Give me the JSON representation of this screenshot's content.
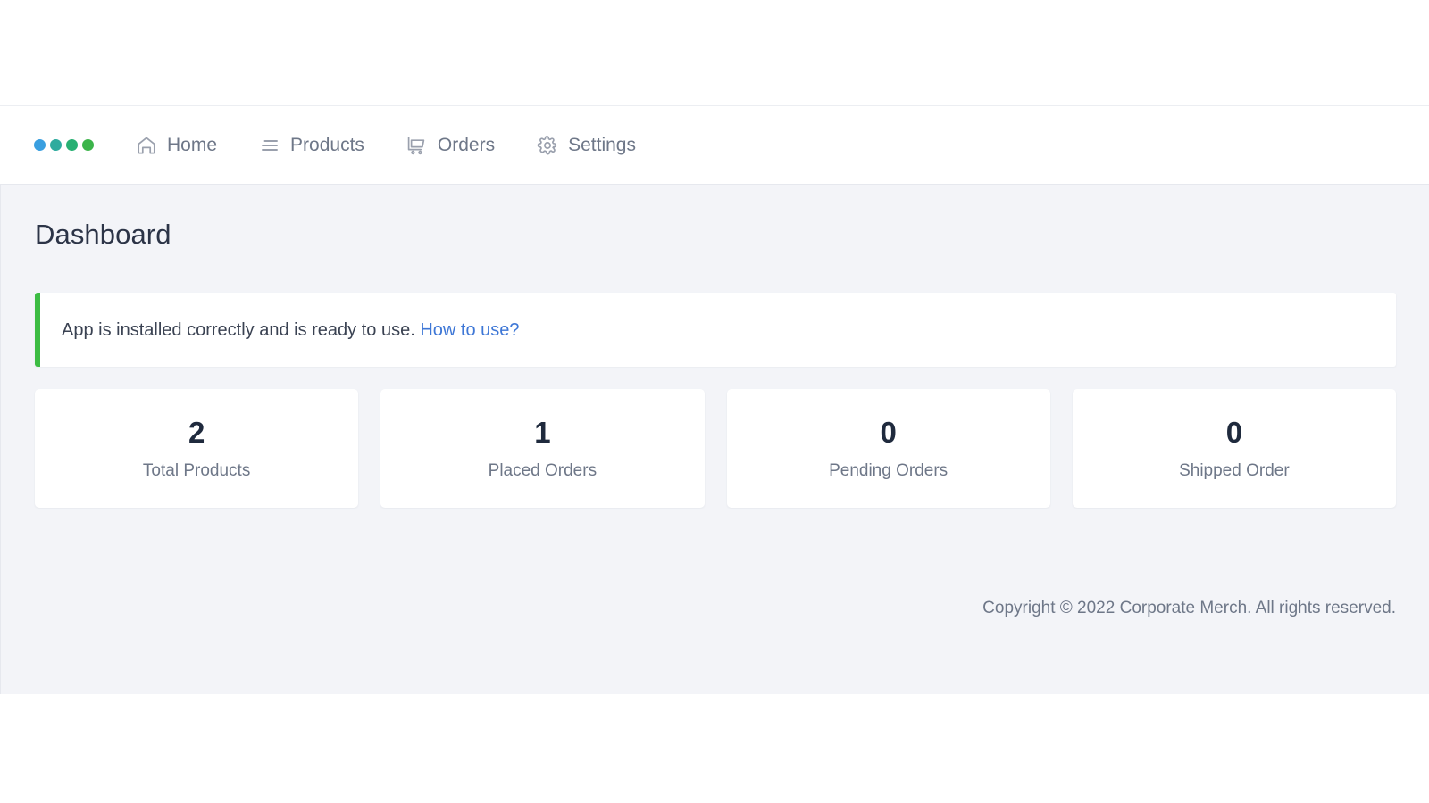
{
  "brand": {
    "name": "corporate-merch-logo",
    "dots": [
      {
        "color": "#3a9fe0"
      },
      {
        "color": "#2eab9e"
      },
      {
        "color": "#28b073"
      },
      {
        "color": "#3cb44a"
      }
    ]
  },
  "nav": {
    "items": [
      {
        "label": "Home",
        "icon": "home-icon"
      },
      {
        "label": "Products",
        "icon": "list-icon"
      },
      {
        "label": "Orders",
        "icon": "shopping-cart-icon"
      },
      {
        "label": "Settings",
        "icon": "gear-icon"
      }
    ]
  },
  "page": {
    "title": "Dashboard"
  },
  "alert": {
    "accent_color": "#3cbc43",
    "message": "App is installed correctly and is ready to use.",
    "link_label": "How to use?",
    "link_color": "#3e77d6"
  },
  "stats": [
    {
      "value": "2",
      "label": "Total Products"
    },
    {
      "value": "1",
      "label": "Placed Orders"
    },
    {
      "value": "0",
      "label": "Pending Orders"
    },
    {
      "value": "0",
      "label": "Shipped Order"
    }
  ],
  "footer": {
    "copyright": "Copyright © 2022 Corporate Merch. All rights reserved."
  }
}
